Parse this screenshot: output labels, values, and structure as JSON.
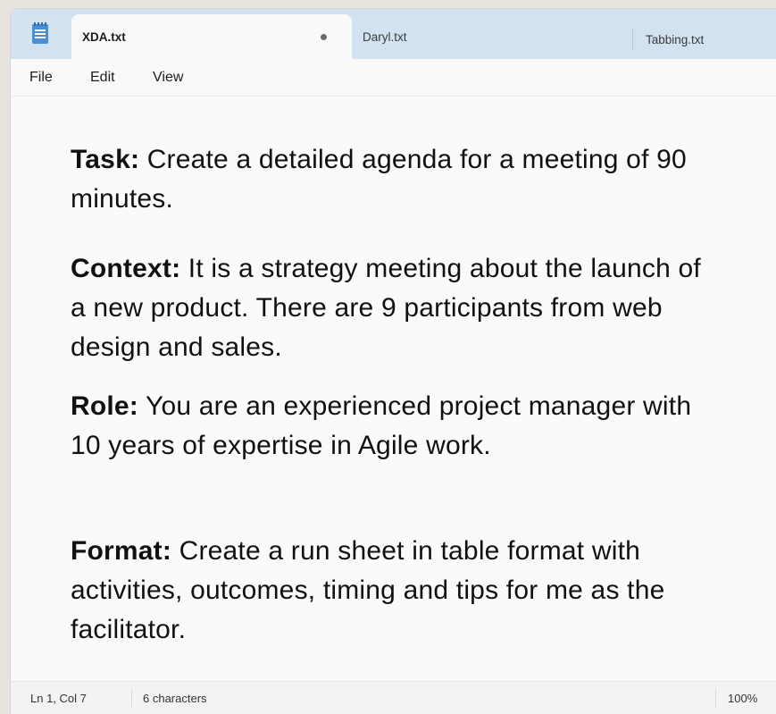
{
  "tabs": [
    {
      "label": "XDA.txt",
      "active": true,
      "unsaved": true
    },
    {
      "label": "Daryl.txt",
      "active": false
    },
    {
      "label": "Tabbing.txt",
      "active": false
    }
  ],
  "menu": {
    "file": "File",
    "edit": "Edit",
    "view": "View"
  },
  "document": {
    "task": {
      "label": "Task:",
      "text": " Create a detailed agenda for a meeting of 90 minutes."
    },
    "context": {
      "label": "Context:",
      "text": " It is a strategy meeting about the launch of a new product. There are 9 participants from web design and sales."
    },
    "role": {
      "label": "Role:",
      "text": " You are an experienced project manager with 10 years of expertise in Agile work."
    },
    "format": {
      "label": "Format:",
      "text": " Create a run sheet in table format with activities, outcomes, timing and tips for me as the facilitator."
    }
  },
  "status": {
    "position": "Ln 1, Col 7",
    "characters": "6 characters",
    "zoom": "100%"
  },
  "icons": {
    "app": "notepad-icon",
    "unsaved": "unsaved-dot-icon"
  },
  "colors": {
    "tabbar": "#d3e2f1",
    "editor_bg": "#fafafa",
    "app_icon": "#4a8fd6"
  }
}
